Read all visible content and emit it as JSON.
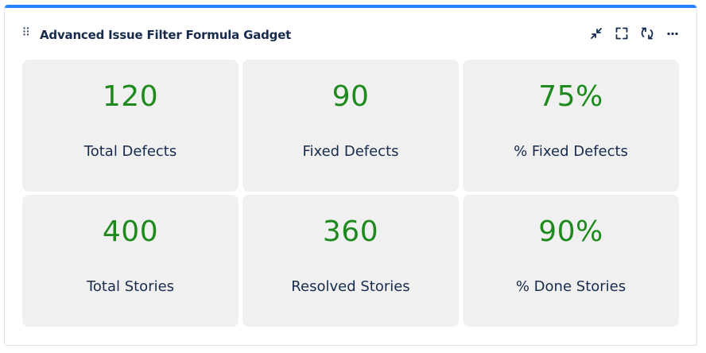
{
  "gadget": {
    "title": "Advanced Issue Filter Formula Gadget",
    "accent_color": "#2684ff",
    "value_color": "#1e8a1e",
    "actions": [
      {
        "icon": "collapse-icon"
      },
      {
        "icon": "fullscreen-icon"
      },
      {
        "icon": "refresh-icon"
      },
      {
        "icon": "more-options-icon"
      }
    ]
  },
  "metrics": [
    {
      "value": "120",
      "label": "Total Defects"
    },
    {
      "value": "90",
      "label": "Fixed Defects"
    },
    {
      "value": "75%",
      "label": "% Fixed Defects"
    },
    {
      "value": "400",
      "label": "Total Stories"
    },
    {
      "value": "360",
      "label": "Resolved Stories"
    },
    {
      "value": "90%",
      "label": "% Done Stories"
    }
  ]
}
